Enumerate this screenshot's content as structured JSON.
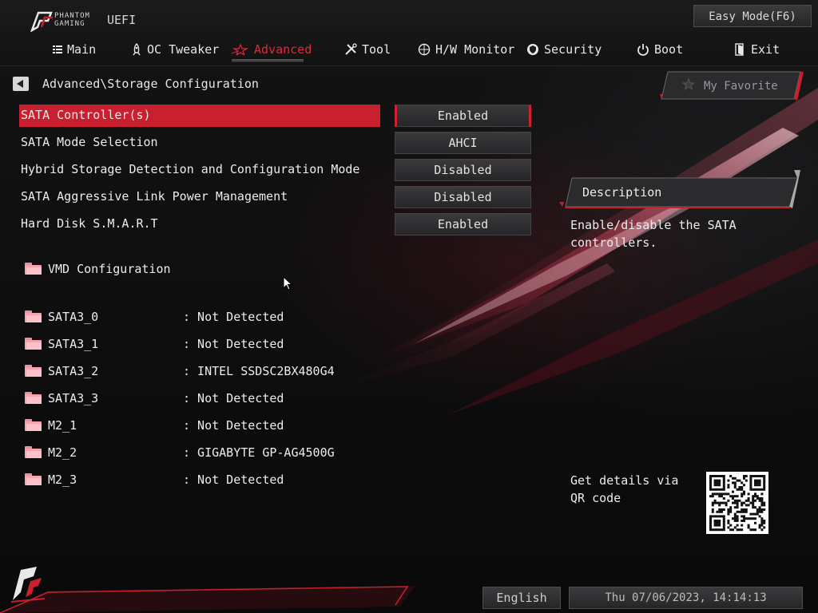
{
  "header": {
    "brand_line1": "PHANTOM",
    "brand_line2": "GAMING",
    "brand_uefi": "UEFI",
    "easy_mode_label": "Easy Mode(F6)"
  },
  "tabs": [
    {
      "label": "Main",
      "icon": "list-icon"
    },
    {
      "label": "OC Tweaker",
      "icon": "rocket-icon"
    },
    {
      "label": "Advanced",
      "icon": "star-icon",
      "active": true
    },
    {
      "label": "Tool",
      "icon": "tools-icon"
    },
    {
      "label": "H/W Monitor",
      "icon": "monitor-icon"
    },
    {
      "label": "Security",
      "icon": "shield-icon"
    },
    {
      "label": "Boot",
      "icon": "power-icon"
    },
    {
      "label": "Exit",
      "icon": "exit-icon"
    }
  ],
  "breadcrumb": "Advanced\\Storage Configuration",
  "favorite_label": "My Favorite",
  "settings": [
    {
      "label": "SATA Controller(s)",
      "value": "Enabled",
      "selected": true
    },
    {
      "label": "SATA Mode Selection",
      "value": "AHCI"
    },
    {
      "label": "Hybrid Storage Detection and Configuration Mode",
      "value": "Disabled"
    },
    {
      "label": "SATA Aggressive Link Power Management",
      "value": "Disabled"
    },
    {
      "label": "Hard Disk S.M.A.R.T",
      "value": "Enabled"
    }
  ],
  "vmd_label": "VMD Configuration",
  "devices": [
    {
      "name": "SATA3_0",
      "value": ": Not Detected"
    },
    {
      "name": "SATA3_1",
      "value": ": Not Detected"
    },
    {
      "name": "SATA3_2",
      "value": ": INTEL SSDSC2BX480G4"
    },
    {
      "name": "SATA3_3",
      "value": ": Not Detected"
    },
    {
      "name": "M2_1",
      "value": ": Not Detected"
    },
    {
      "name": "M2_2",
      "value": ": GIGABYTE GP-AG4500G"
    },
    {
      "name": "M2_3",
      "value": ": Not Detected"
    }
  ],
  "description": {
    "title": "Description",
    "text": "Enable/disable the SATA controllers."
  },
  "qr_text": "Get details via QR code",
  "footer": {
    "language": "English",
    "datetime": "Thu 07/06/2023, 14:14:13"
  },
  "colors": {
    "accent": "#c8202f",
    "background": "#0c0c0d",
    "text": "#e6e6e6"
  }
}
